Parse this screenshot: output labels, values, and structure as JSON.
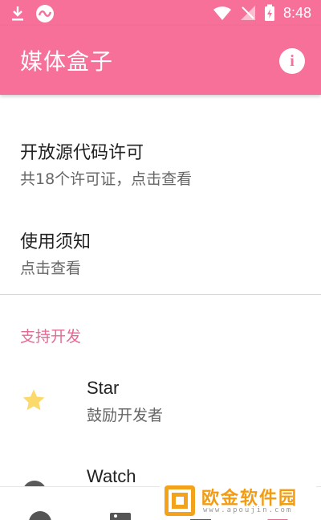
{
  "status_bar": {
    "time": "8:48"
  },
  "toolbar": {
    "title": "媒体盒子",
    "info_icon": "info-icon"
  },
  "license": {
    "title": "开放源代码许可",
    "subtitle": "共18个许可证，点击查看"
  },
  "notice": {
    "title": "使用须知",
    "subtitle": "点击查看"
  },
  "support": {
    "category": "支持开发",
    "items": [
      {
        "title": "Star",
        "subtitle": "鼓励开发者",
        "icon": "star-icon"
      },
      {
        "title": "Watch",
        "icon": "watch-icon"
      }
    ]
  },
  "watermark": {
    "brand": "欧金软件园",
    "url": "www.apoujin.com"
  },
  "colors": {
    "primary": "#f6709a",
    "accent": "#e36a93",
    "star": "#fbd96b"
  }
}
